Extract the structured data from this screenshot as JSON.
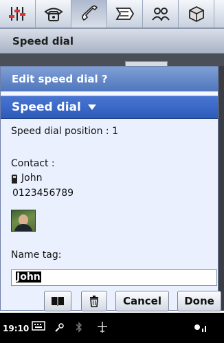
{
  "tabs": [
    {
      "icon": "equalizer-icon",
      "active": false
    },
    {
      "icon": "phone-icon",
      "active": false
    },
    {
      "icon": "handset-icon",
      "active": true
    },
    {
      "icon": "message-icon",
      "active": false
    },
    {
      "icon": "contacts-icon",
      "active": false
    },
    {
      "icon": "box-icon",
      "active": false
    }
  ],
  "window": {
    "title": "Speed dial"
  },
  "dialog": {
    "title": "Edit speed dial ?",
    "section_label": "Speed dial",
    "position_text": "Speed dial position : 1",
    "contact_label": "Contact :",
    "contact_name": "John",
    "contact_number": "0123456789",
    "name_tag_label": "Name tag:",
    "name_tag_value": "John"
  },
  "buttons": {
    "cancel": "Cancel",
    "done": "Done"
  },
  "status": {
    "time": "19:10"
  },
  "colors": {
    "section": "#2d5bbb",
    "header": "#5c81c4",
    "sheet_bg": "#eaf0fd"
  }
}
